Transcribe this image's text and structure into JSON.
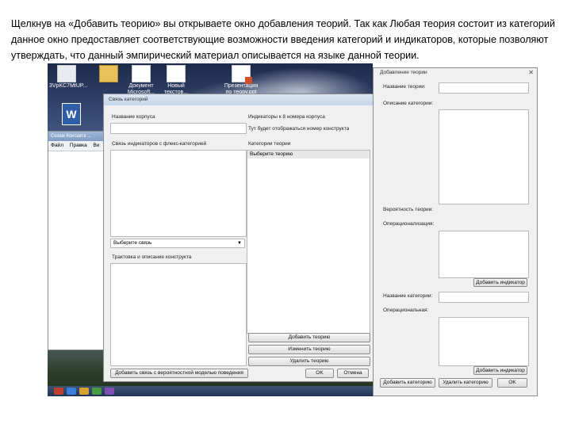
{
  "slide": {
    "caption": "Щелкнув на «Добавить теорию» вы открываете окно добавления теорий. Так как Любая теория состоит из категорий данное окно предоставляет соответствующие возможности введения категорий и индикаторов, которые позволяют утверждать, что данный эмпирический материал описывается на языке данной теории."
  },
  "desktop": {
    "icons": [
      {
        "label": "3VpKC7MtUP..."
      },
      {
        "label": ""
      },
      {
        "label": "Документ Microsoft..."
      },
      {
        "label": "Новый текстов..."
      },
      {
        "label": "Презентация по теору.ppt"
      }
    ]
  },
  "bg_window": {
    "title": "Сезам Контакта ...",
    "menu": "Файл Правка Ви"
  },
  "main_dialog": {
    "title": "Связь категорий",
    "label_corpus_name": "Название корпуса",
    "label_indicators": "Индикаторы к 8 номера корпуса",
    "label_relation": "Связь индикаторов с флекс-категорией",
    "hint_text": "Тут будет отображаться номер конструкта",
    "label_categories": "Категории теории",
    "list_selected": "Выберите теорию",
    "combo_value": "Выберите связь",
    "label_description": "Трактовка и описание конструкта",
    "btn_add_theory": "Добавить теорию",
    "btn_change_theory": "Изменить теорию",
    "btn_delete_theory": "Удалить теорию",
    "btn_add_relation": "Добавить связь с вероятностной моделью поведения",
    "btn_ok": "OK",
    "btn_cancel": "Отмена"
  },
  "theory_dialog": {
    "title": "Добавление теории",
    "label_theory_name": "Название теории:",
    "label_category_description": "Описание категории:",
    "label_category_weight": "Вероятность теории:",
    "label_operationalization": "Операционализация:",
    "btn_add_indicator_1": "Добавить индикатор",
    "label_category_name": "Название категории:",
    "label_operational": "Операциональная:",
    "btn_add_indicator_2": "Добавить индикатор",
    "btn_add_category": "Добавить категорию",
    "btn_delete_category": "Удалить категорию",
    "btn_ok": "OK"
  }
}
